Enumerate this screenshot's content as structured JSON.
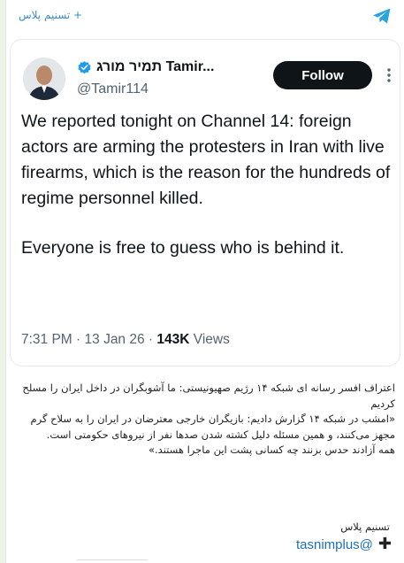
{
  "channel": {
    "header_name": "+ تسنیم پلاس",
    "icon": "telegram-icon"
  },
  "tweet": {
    "display_name": "תמיר מורג Tamir...",
    "handle": "@Tamir114",
    "follow_label": "Follow",
    "verified_icon": "verified-badge-icon",
    "more_icon": "more-dots-icon",
    "paragraphs": [
      "We reported tonight on Channel 14: foreign actors are arming the protesters in Iran with live firearms, which is the reason for the hundreds of regime personnel killed.",
      "Everyone is free to guess who is behind it."
    ],
    "time": "7:31 PM",
    "date": "13 Jan 26",
    "views_count": "143K",
    "views_label": "Views"
  },
  "caption": {
    "lines": [
      "اعتراف افسر رسانه ای شبکه ۱۴ رژیم صهیونیستی: ما آشوبگران در داخل ایران را مسلح کردیم",
      "«امشب در شبکه ۱۴ گزارش دادیم: بازیگران خارجی معترضان در ایران را به سلاح گرم مجهز می‌کنند، و همین مسئله دلیل کشته شدن صدها نفر از نیروهای حکومتی است.",
      "همه آزادند حدس بزنند چه کسانی پشت این ماجرا هستند.»"
    ],
    "source": "تسنیم پلاس",
    "link": "tasnimplus@",
    "link_icon": "plus-icon"
  },
  "colors": {
    "link": "#1d6fb8",
    "follow_bg": "#0f1419",
    "verified": "#1d9bf0",
    "telegram": "#2aa3df"
  }
}
